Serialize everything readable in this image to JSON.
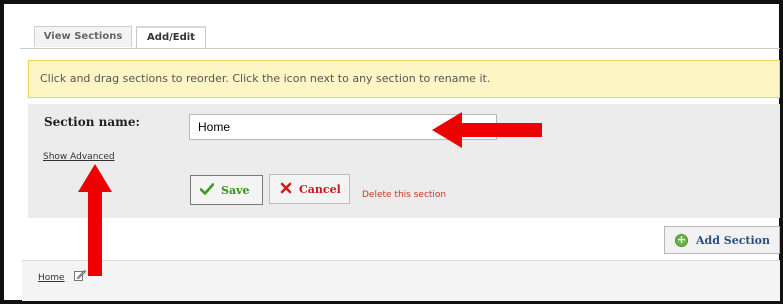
{
  "tabs": [
    {
      "label": "View Sections",
      "active": false
    },
    {
      "label": "Add/Edit",
      "active": true
    }
  ],
  "info_banner": {
    "text": "Click and drag sections to reorder. Click the icon next to any section to rename it."
  },
  "edit_form": {
    "section_name_label": "Section name:",
    "section_name_value": "Home",
    "show_advanced_label": "Show Advanced",
    "save_label": "Save",
    "cancel_label": "Cancel",
    "delete_label": "Delete this section"
  },
  "add_section": {
    "label": "Add Section"
  },
  "sections_list": [
    {
      "label": "Home"
    }
  ],
  "icons": {
    "save": "checkmark-icon",
    "cancel": "x-icon",
    "add_section": "plus-circle-icon",
    "rename": "edit-pencil-icon",
    "annotation": "red-arrow"
  },
  "colors": {
    "banner_bg": "#fdf5c4",
    "banner_border": "#f1d15a",
    "panel_bg": "#ececec",
    "save_text": "#3a8f1c",
    "cancel_text": "#c8171e",
    "delete_text": "#c0392b",
    "add_section_text": "#2b4f80",
    "annotation_arrow": "#ee0000"
  }
}
